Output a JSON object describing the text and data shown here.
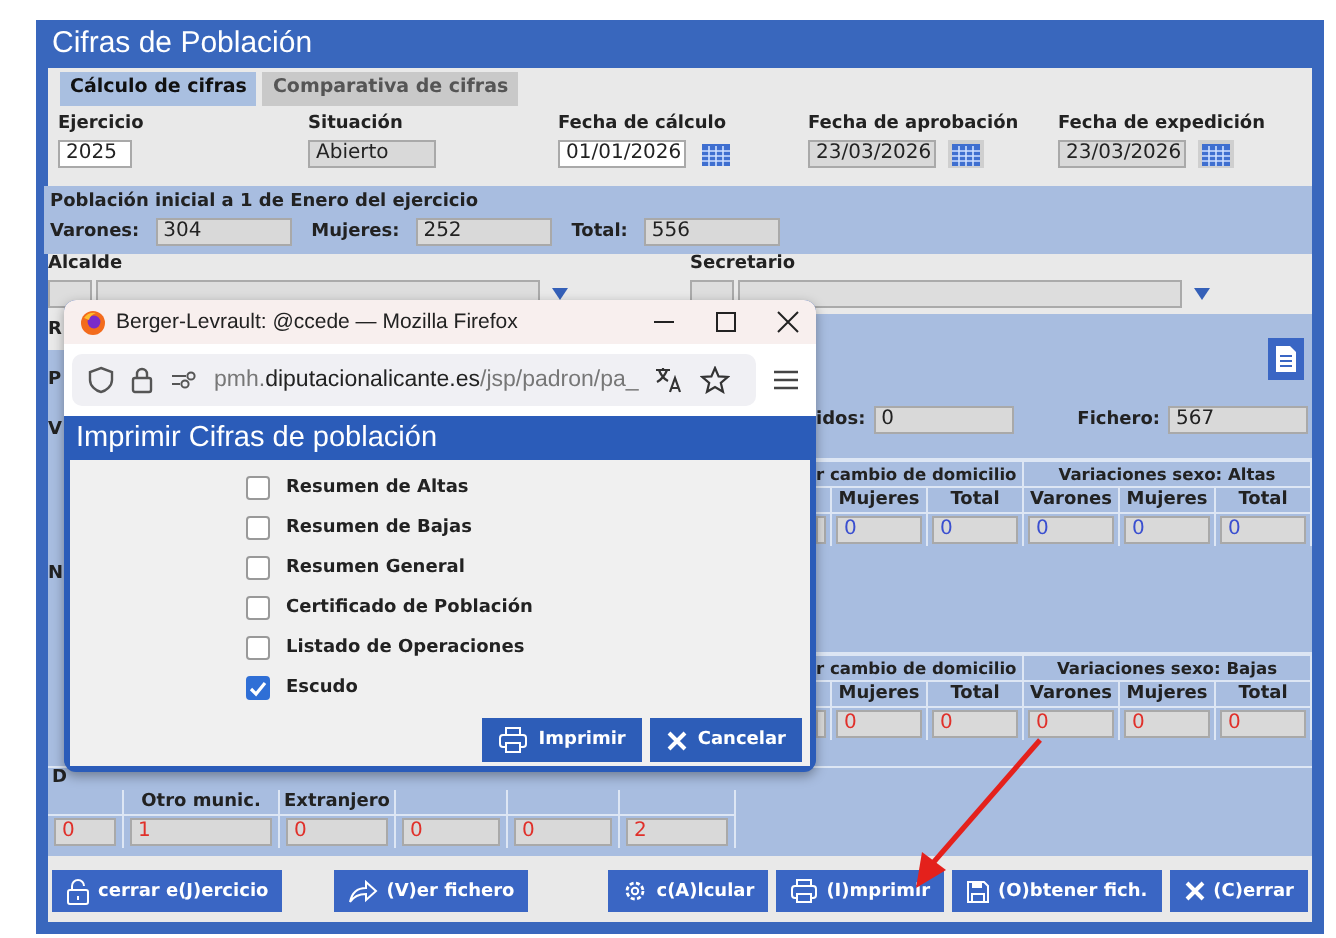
{
  "window": {
    "title": "Cifras de Población"
  },
  "tabs": [
    {
      "label": "Cálculo de cifras",
      "selected": true
    },
    {
      "label": "Comparativa de cifras",
      "selected": false
    }
  ],
  "fields": [
    {
      "label": "Ejercicio",
      "value": "2025",
      "disabled": false,
      "calendar": false
    },
    {
      "label": "Situación",
      "value": "Abierto",
      "disabled": true,
      "calendar": false
    },
    {
      "label": "Fecha de cálculo",
      "value": "01/01/2026",
      "disabled": false,
      "calendar": true
    },
    {
      "label": "Fecha de aprobación",
      "value": "23/03/2026",
      "disabled": true,
      "calendar": true
    },
    {
      "label": "Fecha de expedición",
      "value": "23/03/2026",
      "disabled": true,
      "calendar": true
    }
  ],
  "poblacion_inicial": {
    "title": "Población inicial a 1 de Enero del ejercicio",
    "fields": [
      {
        "label": "Varones:",
        "value": "304"
      },
      {
        "label": "Mujeres:",
        "value": "252"
      },
      {
        "label": "Total:",
        "value": "556"
      }
    ]
  },
  "alcalde": {
    "label": "Alcalde"
  },
  "secretario": {
    "label": "Secretario"
  },
  "left_edge_labels": [
    "R",
    "P",
    "V",
    "N"
  ],
  "totals": [
    {
      "label": "idos:",
      "value": "0"
    },
    {
      "label": "Fichero:",
      "value": "567"
    }
  ],
  "altas_table": {
    "groups": [
      "r cambio de domicilio",
      "Variaciones sexo: Altas"
    ],
    "columns": [
      "Mujeres",
      "Total",
      "Varones",
      "Mujeres",
      "Total"
    ],
    "values": [
      "0",
      "0",
      "0",
      "0",
      "0"
    ]
  },
  "bajas_table": {
    "groups": [
      "r cambio de domicilio",
      "Variaciones sexo: Bajas"
    ],
    "columns": [
      "Mujeres",
      "Total",
      "Varones",
      "Mujeres",
      "Total"
    ],
    "values": [
      "0",
      "0",
      "0",
      "0",
      "0"
    ]
  },
  "bottom_table": {
    "label": "D",
    "cells": [
      {
        "value": "0"
      },
      {
        "header": "Otro munic.",
        "value": "1"
      },
      {
        "header": "Extranjero",
        "value": "0"
      },
      {
        "value": "0"
      },
      {
        "value": "0"
      },
      {
        "value": "2"
      }
    ]
  },
  "buttons": [
    {
      "label": "cerrar e(J)ercicio",
      "kind": "lock"
    },
    {
      "label": "(V)er fichero",
      "kind": "share"
    },
    {
      "label": "c(A)lcular",
      "kind": "gear"
    },
    {
      "label": "(I)mprimir",
      "kind": "print"
    },
    {
      "label": "(O)btener fich.",
      "kind": "save"
    },
    {
      "label": "(C)errar",
      "kind": "close"
    }
  ],
  "popup": {
    "browser_title": "Berger-Levrault: @ccede — Mozilla Firefox",
    "url_host": "pmh.",
    "url_domain": "diputacionalicante.es",
    "url_path": "/jsp/padron/pa_",
    "dialog_title": "Imprimir Cifras de población",
    "options": [
      {
        "label": "Resumen de Altas",
        "checked": false
      },
      {
        "label": "Resumen de Bajas",
        "checked": false
      },
      {
        "label": "Resumen General",
        "checked": false
      },
      {
        "label": "Certificado de Población",
        "checked": false
      },
      {
        "label": "Listado de Operaciones",
        "checked": false
      },
      {
        "label": "Escudo",
        "checked": true
      }
    ],
    "buttons": [
      {
        "label": "Imprimir",
        "kind": "print"
      },
      {
        "label": "Cancelar",
        "kind": "close"
      }
    ]
  }
}
